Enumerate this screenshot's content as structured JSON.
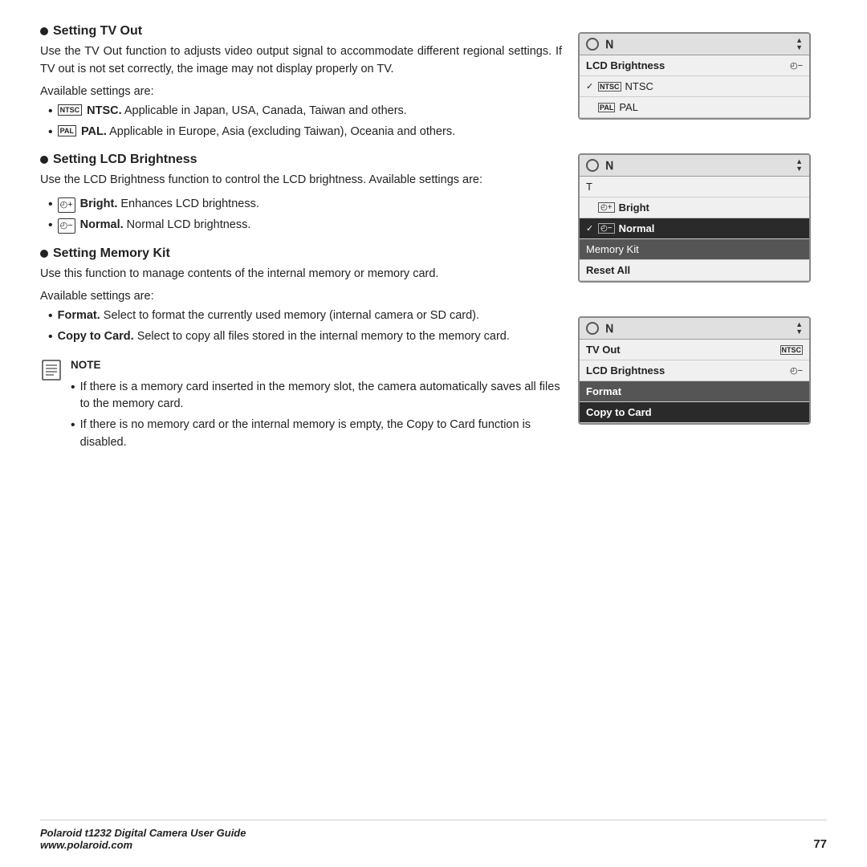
{
  "page": {
    "sections": [
      {
        "id": "tv-out",
        "heading": "Setting TV Out",
        "body": "Use the TV Out function to adjusts video output signal to accommodate different regional settings. If TV out is not set correctly, the image may not display properly on TV.",
        "available_label": "Available settings are:",
        "bullets": [
          {
            "icon": "ntsc",
            "bold": "NTSC.",
            "text": " Applicable in Japan, USA, Canada, Taiwan and others."
          },
          {
            "icon": "pal",
            "bold": "PAL.",
            "text": " Applicable in Europe, Asia (excluding Taiwan), Oceania and others."
          }
        ]
      },
      {
        "id": "lcd-brightness",
        "heading": "Setting LCD Brightness",
        "body": "Use the LCD Brightness function to control the LCD brightness. Available settings are:",
        "bullets": [
          {
            "icon": "lcd",
            "bold": "Bright.",
            "text": " Enhances LCD brightness."
          },
          {
            "icon": "lcd",
            "bold": "Normal.",
            "text": " Normal LCD brightness."
          }
        ]
      },
      {
        "id": "memory-kit",
        "heading": "Setting Memory Kit",
        "body": "Use this function to manage contents of the internal memory or memory card.",
        "available_label": "Available settings are:",
        "bullets": [
          {
            "bold": "Format.",
            "text": " Select to format the currently used memory (internal camera or SD card)."
          },
          {
            "bold": "Copy to Card.",
            "text": " Select to copy all files stored in the internal memory to the memory card."
          }
        ]
      }
    ],
    "note": {
      "title": "NOTE",
      "bullets": [
        "If there is a memory card inserted in the memory slot, the camera automatically saves all files to the memory card.",
        "If there is no memory card or the internal memory is empty, the Copy to Card function is disabled."
      ]
    },
    "screens": {
      "tv_out": {
        "menu_rows": [
          {
            "label": "LCD Brightness",
            "icon": "lcd",
            "selected": false,
            "check": false
          },
          {
            "label": "NTSC",
            "icon": "ntsc",
            "selected": false,
            "check": true
          },
          {
            "label": "PAL",
            "icon": "pal",
            "selected": false,
            "check": false
          }
        ]
      },
      "lcd_brightness": {
        "menu_rows": [
          {
            "label": "Bright",
            "icon": "lcd-bright",
            "selected": false,
            "check": false
          },
          {
            "label": "Normal",
            "icon": "lcd-normal",
            "selected": true,
            "check": true
          },
          {
            "label": "Memory Kit",
            "icon": "",
            "selected": false,
            "check": false,
            "dark": true
          },
          {
            "label": "Reset All",
            "icon": "",
            "selected": false,
            "check": false
          }
        ]
      },
      "memory_kit": {
        "menu_rows": [
          {
            "label": "TV Out",
            "icon": "ntsc-right",
            "selected": false,
            "check": false
          },
          {
            "label": "LCD Brightness",
            "icon": "lcd-right",
            "selected": false,
            "check": false
          },
          {
            "label": "Format",
            "icon": "",
            "selected": false,
            "check": false,
            "dark": true
          },
          {
            "label": "Copy to Card",
            "icon": "",
            "selected": true,
            "check": false
          }
        ]
      }
    },
    "footer": {
      "left_line1": "Polaroid t1232 Digital Camera User Guide",
      "left_line2": "www.polaroid.com",
      "page_number": "77"
    }
  }
}
